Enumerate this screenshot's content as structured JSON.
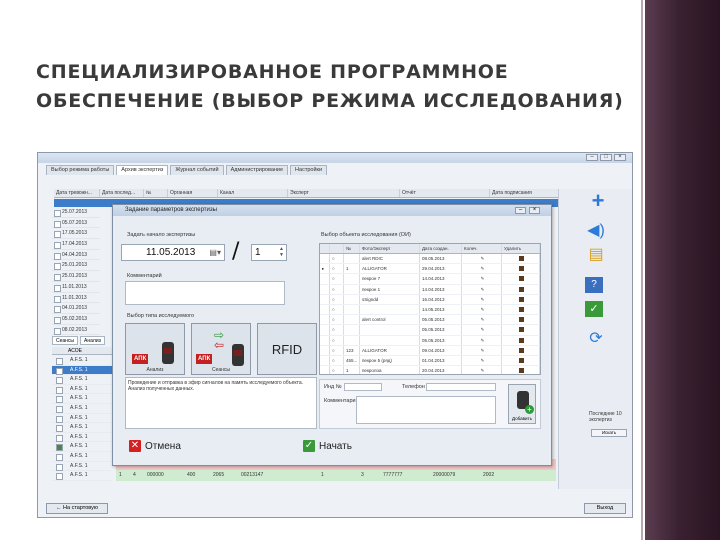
{
  "slide": {
    "title_line1": "СПЕЦИАЛИЗИРОВАННОЕ ПРОГРАММНОЕ",
    "title_line2": "ОБЕСПЕЧЕНИЕ (ВЫБОР РЕЖИМА ИССЛЕДОВАНИЯ)"
  },
  "window": {
    "tabs": [
      "Выбор режима работы",
      "Архив экспертиз",
      "Журнал событий",
      "Администрирование",
      "Настройки"
    ],
    "grid_headers": [
      "Дата тревожн...",
      "Дата послед...",
      "№",
      "Органная",
      "Канал",
      "Эксперт",
      "Отчёт",
      "Дата подписания"
    ],
    "left_dates": [
      "25.07.2013",
      "05.07.2013",
      "17.05.2013",
      "17.04.2013",
      "04.04.2013",
      "25.01.2013",
      "25.01.2013",
      "11.01.2013",
      "11.01.2013",
      "04.01.2013",
      "05.02.2013",
      "08.02.2013",
      "08.02.2013"
    ],
    "bottom_tabs": [
      "Сеансы",
      "Анализ"
    ],
    "aux_header": "АСОЕ",
    "aux_rows": [
      "A.F.S. 1",
      "A.F.S. 1",
      "A.F.S. 1",
      "A.F.S. 1",
      "A.F.S. 1",
      "A.F.S. 1",
      "A.F.S. 1",
      "A.F.S. 1",
      "A.F.S. 1",
      "A.F.S. 1",
      "A.F.S. 1",
      "A.F.S. 1",
      "A.F.S. 1"
    ],
    "lower_rows": [
      {
        "c1": "1",
        "c2": "2",
        "c3": "000000",
        "c4": "400",
        "c5": "2065",
        "c6": "00213147",
        "c7": "1",
        "c8": "3",
        "c9": "7777777",
        "c10": "20000079",
        "c11": "2002",
        "tone": "red"
      },
      {
        "c1": "1",
        "c2": "4",
        "c3": "000000",
        "c4": "400",
        "c5": "2065",
        "c6": "00213147",
        "c7": "1",
        "c8": "3",
        "c9": "7777777",
        "c10": "20000079",
        "c11": "2002",
        "tone": "green"
      }
    ],
    "back_button": "← На стартовую",
    "exit_button": "Выход",
    "right_panel_notes": [
      "Последние 10 экспертиз",
      "Искать"
    ]
  },
  "dialog": {
    "title": "Задание параметров экспертизы",
    "start_label": "Задать начало экспертизы",
    "date_value": "11.05.2013",
    "number_value": "1",
    "comment_label": "Комментарий",
    "mode_label": "Выбор типа исследуемого",
    "modes": [
      {
        "label": "Анализ",
        "kind": "single"
      },
      {
        "label": "Сеансы",
        "kind": "pair"
      },
      {
        "label": "RFID",
        "kind": "rfid"
      }
    ],
    "apk_badge": "АПК",
    "description": "Проведение и отправка в эфир сигналов на память исследуемого объекта. Анализ полученных данных.",
    "cancel_label": "Отмена",
    "start_button_label": "Начать",
    "object_section_label": "Выбор объекта исследования (ОИ)",
    "object_headers": [
      "",
      "",
      "№",
      "Фото/Эксперт",
      "Дата создан.",
      "Колеч.",
      "Удалить"
    ],
    "object_rows": [
      {
        "n": "",
        "name": "alert RDIC",
        "date": "08.05.2013"
      },
      {
        "n": "1",
        "name": "ALLIGATOR",
        "date": "29.04.2013"
      },
      {
        "n": "",
        "name": "пекрон 7",
        "date": "14.04.2013"
      },
      {
        "n": "",
        "name": "пекрон 1",
        "date": "14.04.2013"
      },
      {
        "n": "",
        "name": "sSigndd",
        "date": "16.04.2013"
      },
      {
        "n": "",
        "name": "",
        "date": "14.05.2013"
      },
      {
        "n": "",
        "name": "alert control",
        "date": "05.05.2013"
      },
      {
        "n": "",
        "name": "",
        "date": "05.05.2013"
      },
      {
        "n": "",
        "name": "",
        "date": "05.05.2013"
      },
      {
        "n": "123",
        "name": "ALLIGATOR",
        "date": "09.04.2013"
      },
      {
        "n": "455...",
        "name": "пекрон 5 (ряд)",
        "date": "01.04.2013"
      },
      {
        "n": "1",
        "name": "пекролоа",
        "date": "20.04.2013"
      }
    ],
    "form_labels": {
      "num": "Инд №",
      "phone": "Телефон",
      "comment": "Комментарий"
    },
    "add_button": "Добавить"
  }
}
